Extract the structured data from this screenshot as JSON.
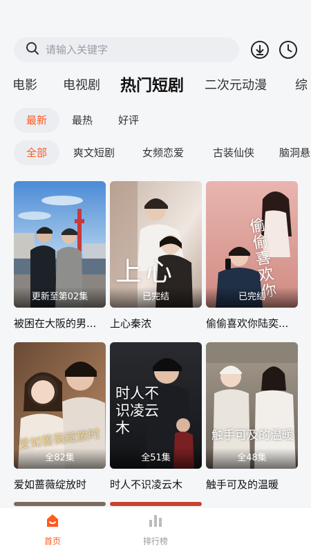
{
  "search": {
    "placeholder": "请输入关键字"
  },
  "top_icons": [
    "download-icon",
    "history-clock-icon"
  ],
  "category_tabs": [
    {
      "label": "电影"
    },
    {
      "label": "电视剧"
    },
    {
      "label": "热门短剧",
      "active": true
    },
    {
      "label": "二次元动漫"
    },
    {
      "label": "综"
    }
  ],
  "sort_filters": [
    {
      "label": "最新",
      "active": true
    },
    {
      "label": "最热"
    },
    {
      "label": "好评"
    }
  ],
  "genre_filters": [
    {
      "label": "全部",
      "active": true
    },
    {
      "label": "爽文短剧"
    },
    {
      "label": "女频恋爱"
    },
    {
      "label": "古装仙侠"
    },
    {
      "label": "脑洞悬"
    }
  ],
  "dramas": [
    {
      "title": "被困在大阪的男...",
      "status": "更新至第02集"
    },
    {
      "title": "上心秦浓",
      "status": "已完结"
    },
    {
      "title": "偷偷喜欢你陆奕...",
      "status": "已完结"
    },
    {
      "title": "爱如蔷薇绽放时",
      "status": "全82集"
    },
    {
      "title": "时人不识凌云木",
      "status": "全51集"
    },
    {
      "title": "触手可及的温暖",
      "status": "全48集"
    }
  ],
  "poster_texts": {
    "p2": "上心",
    "p3": "偷偷喜欢你",
    "p4": "爱如蔷薇绽放时",
    "p5": "时人不识凌云木",
    "p6": "触手可及的温暖"
  },
  "bottom_nav": [
    {
      "label": "首页",
      "active": true
    },
    {
      "label": "排行榜"
    }
  ],
  "colors": {
    "accent": "#ff5a1f",
    "inactive": "#999999"
  }
}
